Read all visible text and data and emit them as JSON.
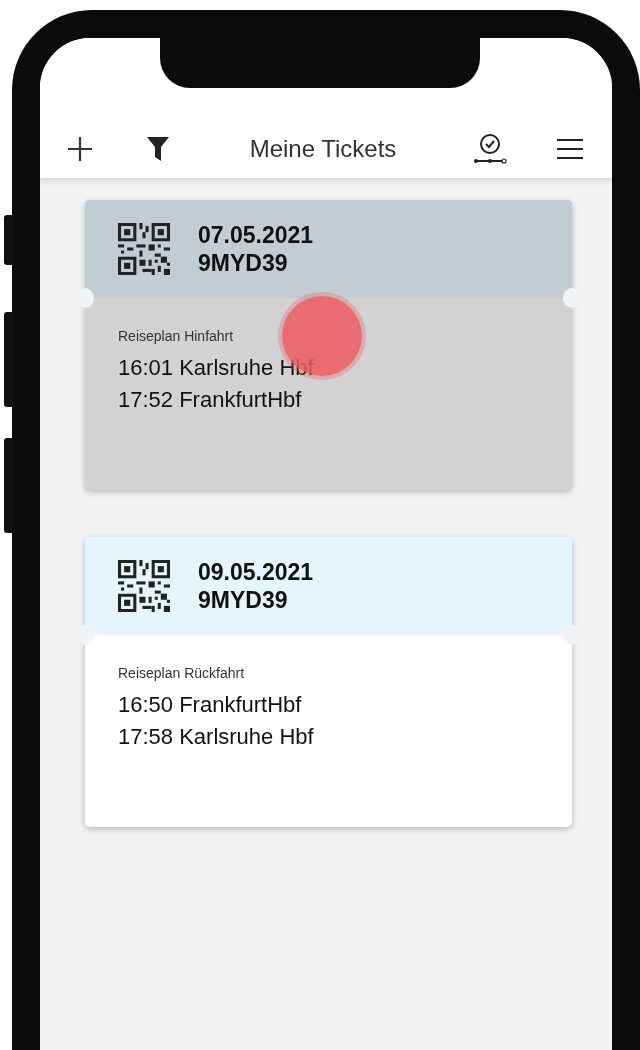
{
  "app_bar": {
    "title": "Meine Tickets"
  },
  "tickets": [
    {
      "date": "07.05.2021",
      "code": "9MYD39",
      "plan_label": "Reiseplan Hinfahrt",
      "stops": [
        "16:01 Karlsruhe Hbf",
        "17:52 FrankfurtHbf"
      ],
      "pressed": true
    },
    {
      "date": "09.05.2021",
      "code": "9MYD39",
      "plan_label": "Reiseplan Rückfahrt",
      "stops": [
        "16:50 FrankfurtHbf",
        "17:58 Karlsruhe Hbf"
      ],
      "pressed": false
    }
  ]
}
